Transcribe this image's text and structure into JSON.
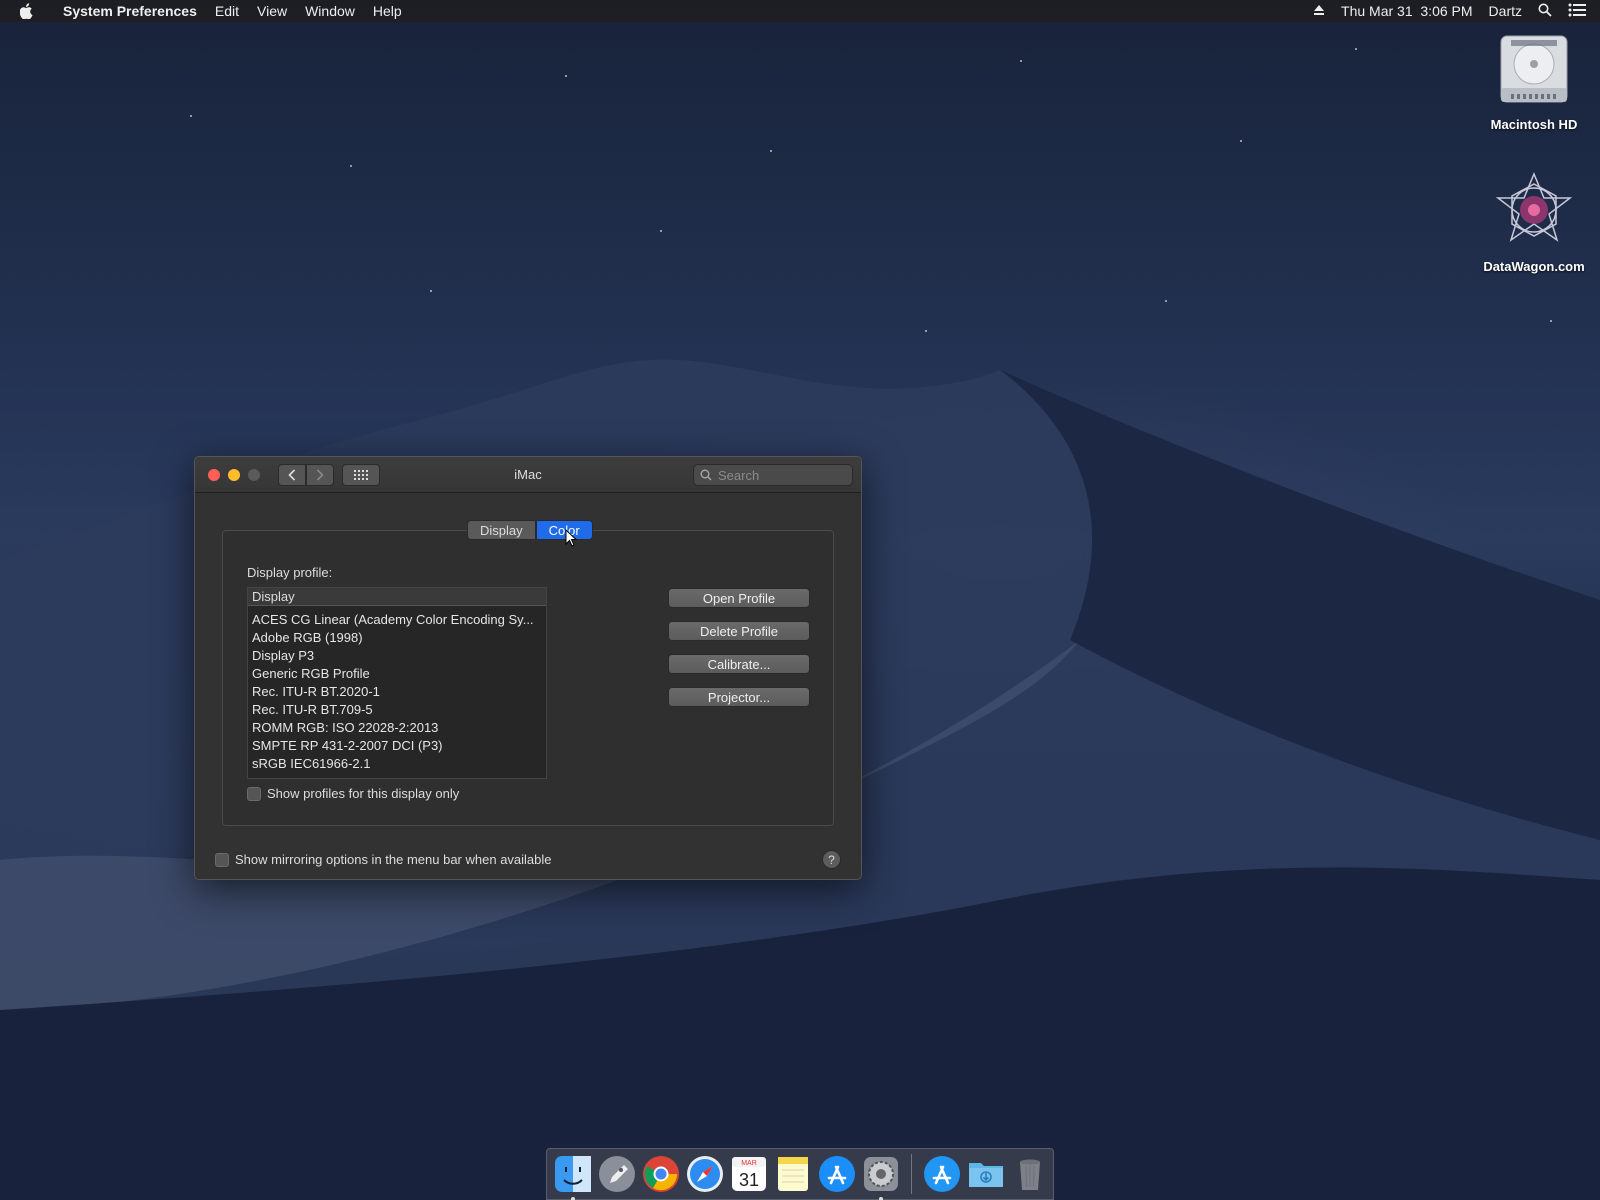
{
  "menubar": {
    "app_name": "System Preferences",
    "menus": [
      "Edit",
      "View",
      "Window",
      "Help"
    ],
    "datetime": "Thu Mar 31  3:06 PM",
    "user": "Dartz"
  },
  "desktop_icons": [
    "Macintosh HD",
    "DataWagon.com"
  ],
  "window": {
    "title": "iMac",
    "search_placeholder": "Search",
    "tabs": [
      "Display",
      "Color"
    ],
    "active_tab": "Color",
    "profile_label": "Display profile:",
    "list_header": "Display",
    "profiles": [
      "ACES CG Linear (Academy Color Encoding Sy...",
      "Adobe RGB (1998)",
      "Display P3",
      "Generic RGB Profile",
      "Rec. ITU-R BT.2020-1",
      "Rec. ITU-R BT.709-5",
      "ROMM RGB: ISO 22028-2:2013",
      "SMPTE RP 431-2-2007 DCI (P3)",
      "sRGB IEC61966-2.1"
    ],
    "show_profiles_label": "Show profiles for this display only",
    "buttons": {
      "open": "Open Profile",
      "delete": "Delete Profile",
      "calibrate": "Calibrate...",
      "projector": "Projector..."
    },
    "mirroring_label": "Show mirroring options in the menu bar when available",
    "help": "?"
  },
  "dock": {
    "calendar_month": "MAR",
    "calendar_day": "31",
    "items": [
      "finder-icon",
      "launchpad-icon",
      "chrome-icon",
      "safari-icon",
      "calendar-icon",
      "notes-icon",
      "app-store-icon",
      "system-preferences-icon",
      "app-store-folder-icon",
      "downloads-folder-icon",
      "trash-icon"
    ]
  },
  "colors": {
    "accent": "#1f6bea",
    "close": "#ff5f57",
    "minimize": "#febc2e"
  }
}
